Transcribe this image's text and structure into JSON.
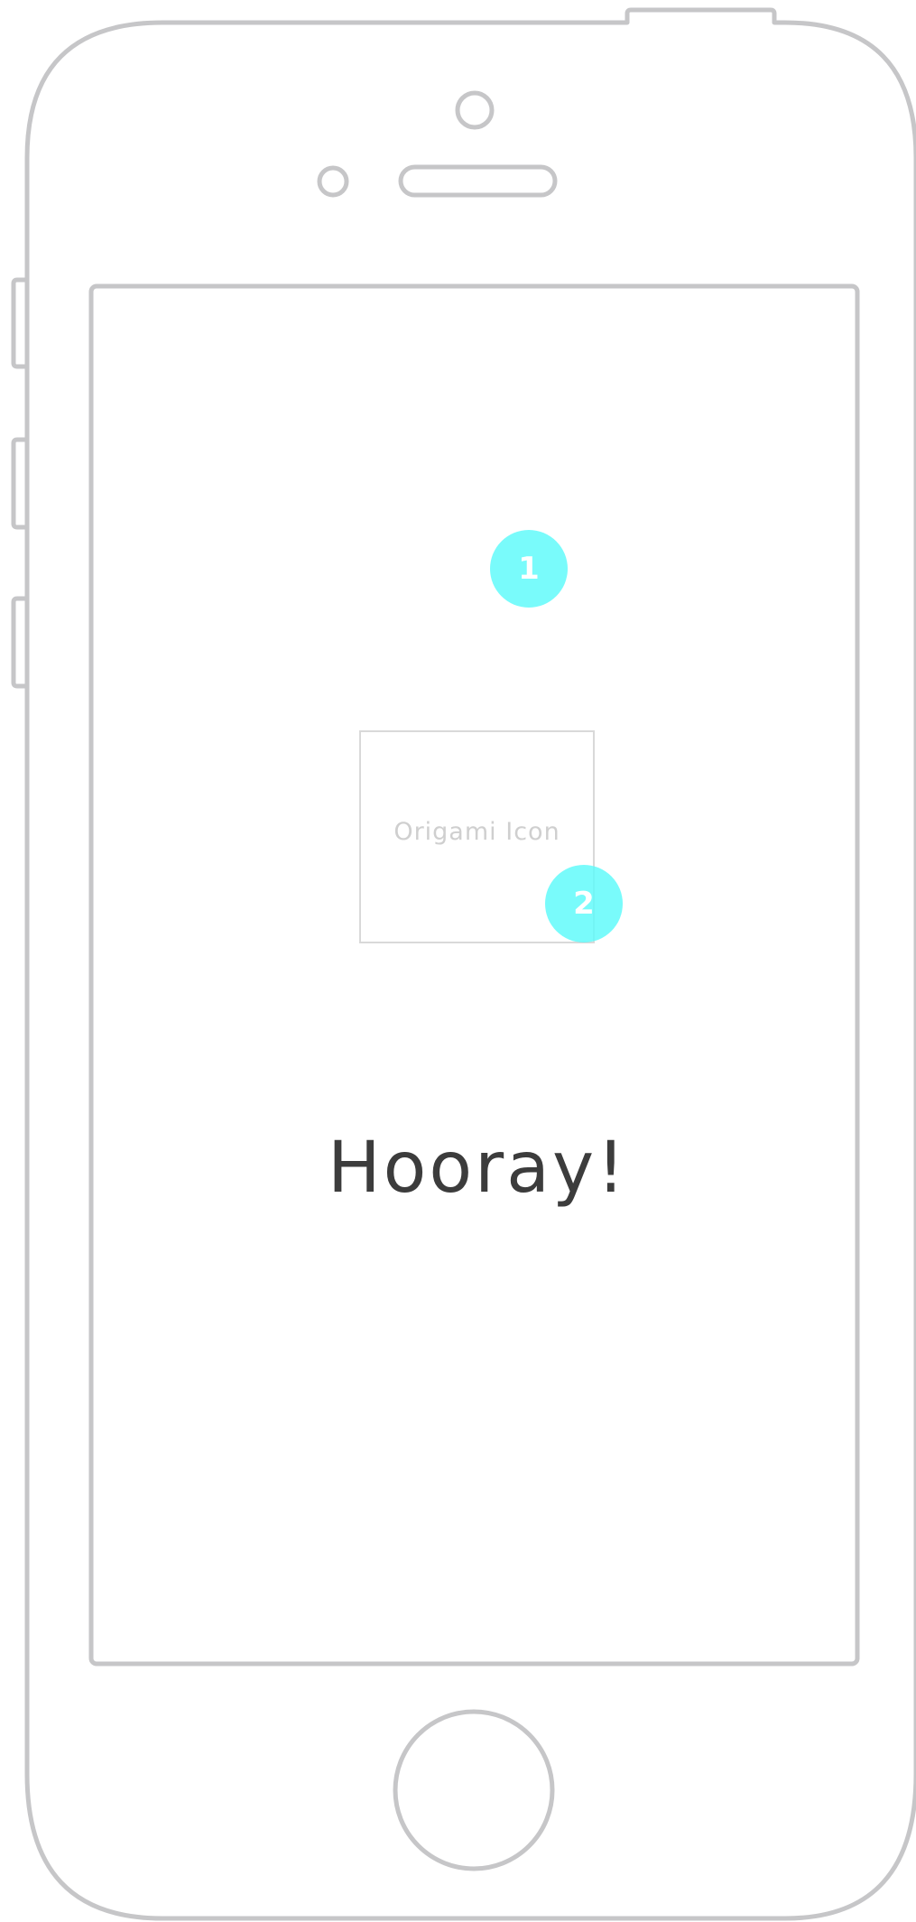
{
  "device": {
    "model": "phone-wireframe",
    "outline_color": "#c6c6c8"
  },
  "app": {
    "icon_placeholder": {
      "label": "Origami Icon"
    },
    "headline": {
      "text": "Hooray!"
    }
  },
  "annotations": [
    {
      "number": "1",
      "target": "icon-placeholder"
    },
    {
      "number": "2",
      "target": "headline"
    }
  ],
  "colors": {
    "marker": "#5cfafa",
    "headline_text": "#3c3c3c",
    "placeholder_border": "#d9d9d9",
    "placeholder_text": "#cfcfcf"
  }
}
